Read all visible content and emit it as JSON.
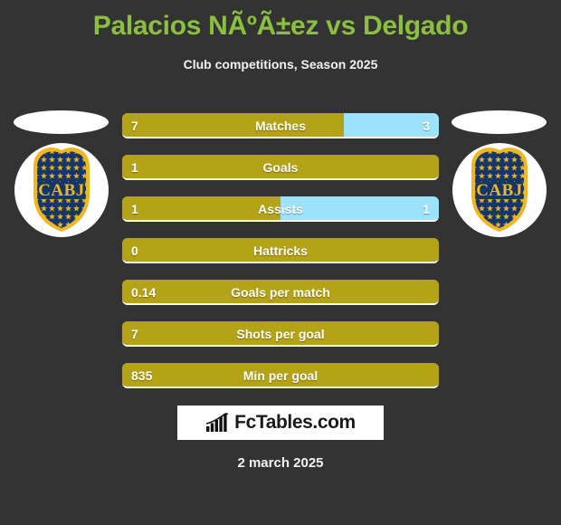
{
  "header": {
    "title": "Palacios NÃºÃ±ez vs Delgado",
    "subtitle": "Club competitions, Season 2025"
  },
  "colors": {
    "background": "#333333",
    "title": "#8CBF3F",
    "home_bar": "#B5A317",
    "away_bar": "#9BE2FA",
    "crest_blue": "#14366B",
    "crest_gold": "#F0B71E"
  },
  "teams": {
    "home_crest_label": "CABJ",
    "away_crest_label": "CABJ"
  },
  "stats": [
    {
      "label": "Matches",
      "home": "7",
      "away": "3",
      "home_pct": 70
    },
    {
      "label": "Goals",
      "home": "1",
      "away": "",
      "home_pct": 100
    },
    {
      "label": "Assists",
      "home": "1",
      "away": "1",
      "home_pct": 50
    },
    {
      "label": "Hattricks",
      "home": "0",
      "away": "",
      "home_pct": 100
    },
    {
      "label": "Goals per match",
      "home": "0.14",
      "away": "",
      "home_pct": 100
    },
    {
      "label": "Shots per goal",
      "home": "7",
      "away": "",
      "home_pct": 100
    },
    {
      "label": "Min per goal",
      "home": "835",
      "away": "",
      "home_pct": 100
    }
  ],
  "footer": {
    "logo_text": "FcTables.com",
    "date": "2 march 2025"
  }
}
